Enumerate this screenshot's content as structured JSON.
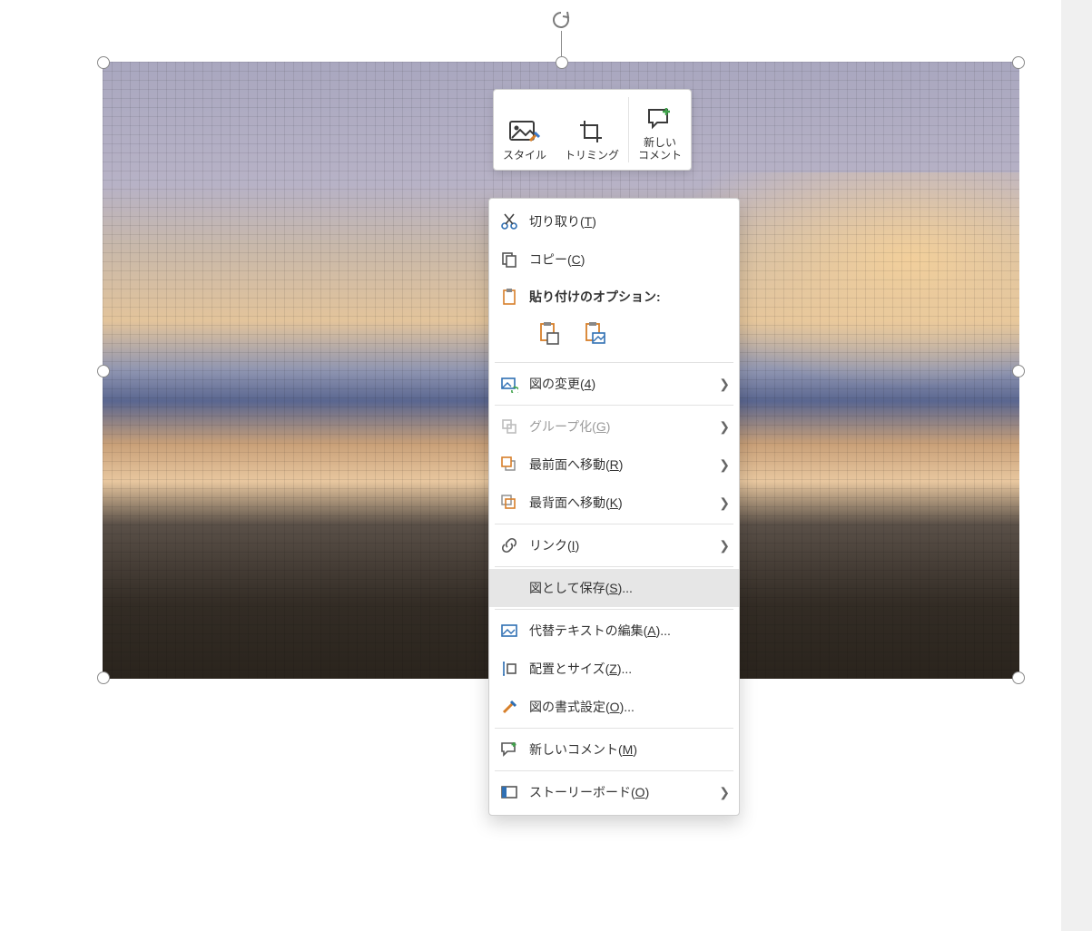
{
  "mini_toolbar": {
    "style": "スタイル",
    "crop": "トリミング",
    "comment": "新しい\nコメント"
  },
  "context_menu": {
    "cut": {
      "label": "切り取り",
      "accel": "T"
    },
    "copy": {
      "label": "コピー",
      "accel": "C"
    },
    "paste_header": {
      "label": "貼り付けのオプション:"
    },
    "change_picture": {
      "label": "図の変更",
      "accel": "4",
      "submenu": true
    },
    "group": {
      "label": "グループ化",
      "accel": "G",
      "submenu": true,
      "disabled": true
    },
    "bring_front": {
      "label": "最前面へ移動",
      "accel": "R",
      "submenu": true
    },
    "send_back": {
      "label": "最背面へ移動",
      "accel": "K",
      "submenu": true
    },
    "link": {
      "label": "リンク",
      "accel": "I",
      "submenu": true
    },
    "save_as_pic": {
      "label": "図として保存",
      "accel": "S",
      "trail": "...",
      "highlight": true
    },
    "alt_text": {
      "label": "代替テキストの編集",
      "accel": "A",
      "trail": "..."
    },
    "size_pos": {
      "label": "配置とサイズ",
      "accel": "Z",
      "trail": "..."
    },
    "format_pic": {
      "label": "図の書式設定",
      "accel": "O",
      "trail": "..."
    },
    "new_comment": {
      "label": "新しいコメント",
      "accel": "M"
    },
    "storyboard": {
      "label": "ストーリーボード",
      "accel": "O",
      "submenu": true
    }
  }
}
